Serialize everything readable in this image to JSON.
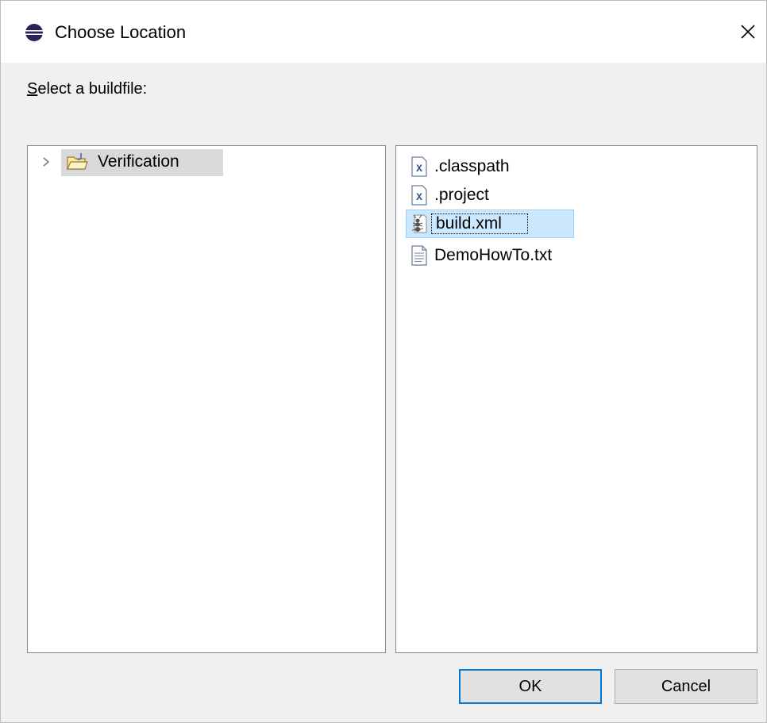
{
  "window": {
    "title": "Choose Location",
    "close_glyph": "✕",
    "app_icon": "eclipse-icon"
  },
  "prompt": {
    "accelerator": "S",
    "rest": "elect a buildfile:"
  },
  "tree": {
    "items": [
      {
        "label": "Verification",
        "icon": "project-folder-icon",
        "expanded": false,
        "selected": true
      }
    ]
  },
  "files": {
    "items": [
      {
        "label": ".classpath",
        "icon": "xml-file-icon",
        "selected": false
      },
      {
        "label": ".project",
        "icon": "xml-file-icon",
        "selected": false
      },
      {
        "label": "build.xml",
        "icon": "ant-buildfile-icon",
        "selected": true
      },
      {
        "label": "DemoHowTo.txt",
        "icon": "text-file-icon",
        "selected": false
      }
    ]
  },
  "buttons": {
    "ok": "OK",
    "cancel": "Cancel"
  },
  "colors": {
    "selection_bg": "#cce8ff",
    "selection_border": "#99d1ff",
    "default_button_border": "#0078d7"
  }
}
